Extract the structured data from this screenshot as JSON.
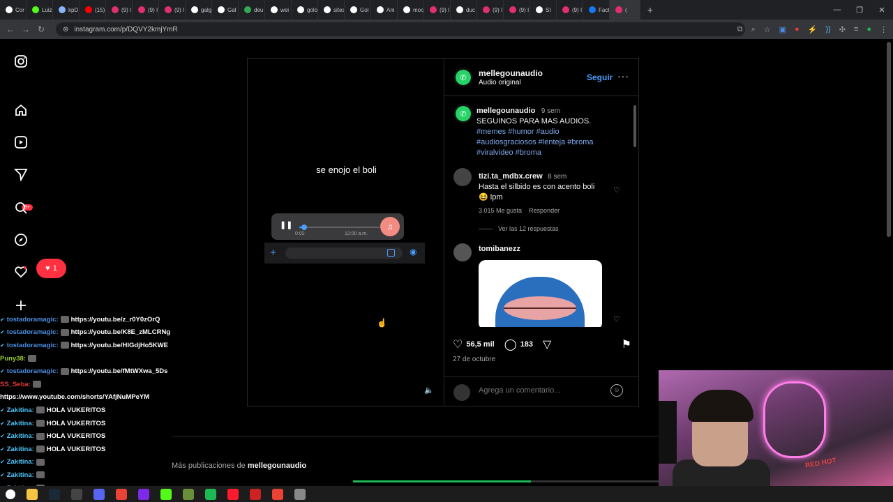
{
  "browser": {
    "tabs": [
      {
        "label": "Cor",
        "color": "#ffffff"
      },
      {
        "label": "Luiz",
        "color": "#53fc18"
      },
      {
        "label": "kpD",
        "color": "#8ab4f8"
      },
      {
        "label": "(15)",
        "color": "#ff0000"
      },
      {
        "label": "(9) I",
        "color": "#e1306c"
      },
      {
        "label": "(9) I",
        "color": "#e1306c"
      },
      {
        "label": "(9) I",
        "color": "#e1306c"
      },
      {
        "label": "galg",
        "color": "#ffffff"
      },
      {
        "label": "Gal",
        "color": "#ffffff"
      },
      {
        "label": "deu",
        "color": "#34a853"
      },
      {
        "label": "wei",
        "color": "#ffffff"
      },
      {
        "label": "golo",
        "color": "#ffffff"
      },
      {
        "label": "sites",
        "color": "#ffffff"
      },
      {
        "label": "Gol",
        "color": "#ffffff"
      },
      {
        "label": "Ani",
        "color": "#ffffff"
      },
      {
        "label": "moc",
        "color": "#ffffff"
      },
      {
        "label": "(9) I",
        "color": "#e1306c"
      },
      {
        "label": "duc",
        "color": "#ffffff"
      },
      {
        "label": "(9) I",
        "color": "#e1306c"
      },
      {
        "label": "(9) I",
        "color": "#e1306c"
      },
      {
        "label": "SI",
        "color": "#ffffff"
      },
      {
        "label": "(9) I",
        "color": "#e1306c"
      },
      {
        "label": "Fact",
        "color": "#1877f2"
      },
      {
        "label": "(",
        "color": "#e1306c"
      }
    ],
    "url": "instagram.com/p/DQVY2kmjYmR"
  },
  "sidebar": {
    "notif_badge": "9+",
    "like_count": "1"
  },
  "video": {
    "caption": "se enojo el boli",
    "audio_time": "0:02",
    "audio_clock": "12:00 a.m.",
    "progress": 0.06
  },
  "post": {
    "username": "mellegounaudio",
    "audio": "Audio original",
    "follow": "Seguir",
    "caption": {
      "username": "mellegounaudio",
      "time": "9 sem",
      "text": "SEGUINOS PARA MAS AUDIOS.",
      "tags_line1": "#memes #humor #audio",
      "tags_line2": "#audiosgraciosos #lenteja #broma",
      "tags_line3": "#viralvideo #broma"
    },
    "comments": [
      {
        "username": "tizi.ta_mdbx.crew",
        "time": "8 sem",
        "text_line1": "Hasta el silbido es con acento boli",
        "text_line2": "😆 lpm",
        "likes": "3.015 Me gusta",
        "reply": "Responder",
        "view_replies": "Ver las 12 respuestas"
      },
      {
        "username": "tomibanezz"
      }
    ],
    "likes": "56,5 mil",
    "comments_count": "183",
    "date": "27 de octubre",
    "add_comment_placeholder": "Agrega un comentario..."
  },
  "more_posts": {
    "prefix": "Más publicaciones de",
    "username": "mellegounaudio"
  },
  "stream_progress": 0.58,
  "chat": [
    {
      "name": "tostadoramagic:",
      "color": "#4a90e2",
      "msg": "https://youtu.be/z_r0Y0zOrQ",
      "check": true
    },
    {
      "name": "tostadoramagic:",
      "color": "#4a90e2",
      "msg": "https://youtu.be/K8E_zMLCRNg",
      "check": true
    },
    {
      "name": "tostadoramagic:",
      "color": "#4a90e2",
      "msg": "https://youtu.be/HIGdjHo5KWE",
      "check": true
    },
    {
      "name": "Puny38:",
      "color": "#9acd32",
      "msg": "",
      "check": false
    },
    {
      "name": "tostadoramagic:",
      "color": "#4a90e2",
      "msg": "https://youtu.be/fMtWXwa_5Ds",
      "check": true
    },
    {
      "name": "SS_Seba:",
      "color": "#e53935",
      "msg": "",
      "check": false
    },
    {
      "name": "",
      "color": "#ffffff",
      "msg": "https://www.youtube.com/shorts/YAfjNuMPeYM",
      "check": false
    },
    {
      "name": "Zakitina:",
      "color": "#4fc3f7",
      "msg": "HOLA VUKERITOS",
      "check": true
    },
    {
      "name": "Zakitina:",
      "color": "#4fc3f7",
      "msg": "HOLA VUKERITOS",
      "check": true
    },
    {
      "name": "Zakitina:",
      "color": "#4fc3f7",
      "msg": "HOLA VUKERITOS",
      "check": true
    },
    {
      "name": "Zakitina:",
      "color": "#4fc3f7",
      "msg": "HOLA VUKERITOS",
      "check": true
    },
    {
      "name": "Zakitina:",
      "color": "#4fc3f7",
      "msg": "",
      "check": true
    },
    {
      "name": "Zakitina:",
      "color": "#4fc3f7",
      "msg": "",
      "check": true
    },
    {
      "name": "Zakitina:",
      "color": "#4fc3f7",
      "msg": "",
      "check": true
    },
    {
      "name": "Zakitina:",
      "color": "#4fc3f7",
      "msg": "",
      "check": true
    }
  ],
  "webcam": {
    "shirt_text": "RED HOT"
  },
  "taskbar": [
    {
      "name": "folder-icon",
      "color": "#f4c542"
    },
    {
      "name": "steam-icon",
      "color": "#1b2838"
    },
    {
      "name": "obs-icon",
      "color": "#444444"
    },
    {
      "name": "discord-icon",
      "color": "#5865f2"
    },
    {
      "name": "chrome-icon",
      "color": "#ea4335"
    },
    {
      "name": "canva-icon",
      "color": "#7d2ae8"
    },
    {
      "name": "kick-icon",
      "color": "#53fc18"
    },
    {
      "name": "minecraft-icon",
      "color": "#6a8f3a"
    },
    {
      "name": "spotify-icon",
      "color": "#1db954"
    },
    {
      "name": "opera-icon",
      "color": "#ff1b2d"
    },
    {
      "name": "app-icon",
      "color": "#cc2222"
    },
    {
      "name": "chrome-icon",
      "color": "#ea4335"
    },
    {
      "name": "cursor-icon",
      "color": "#888888"
    }
  ]
}
